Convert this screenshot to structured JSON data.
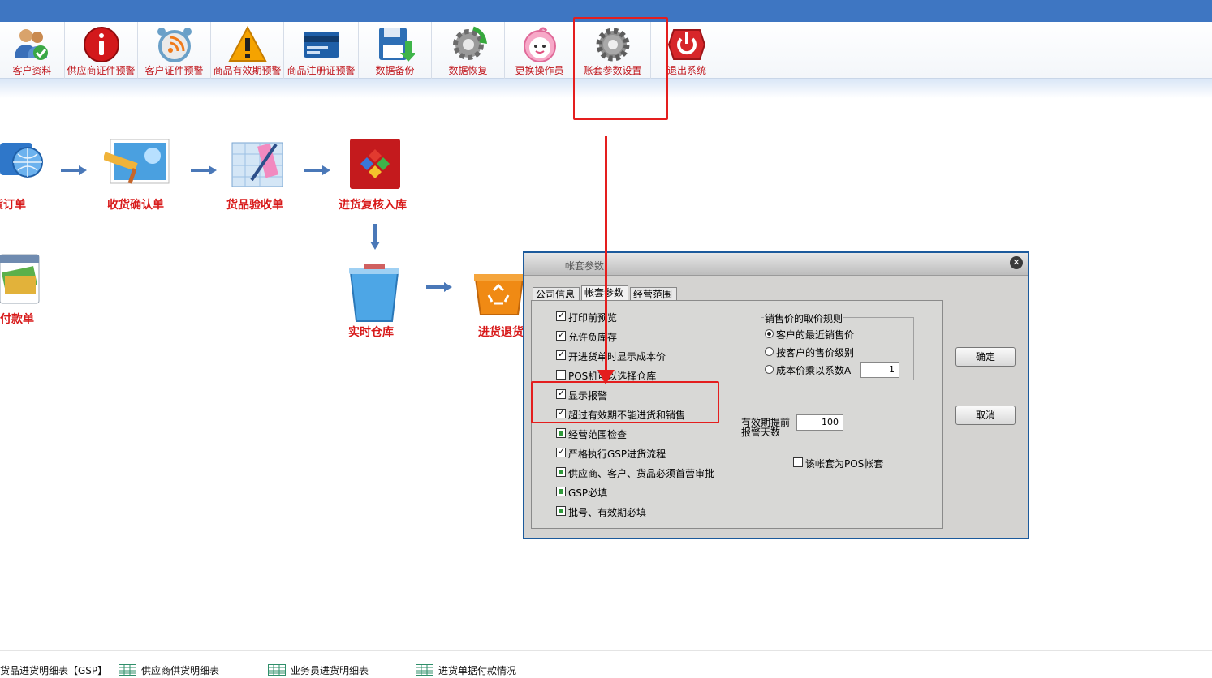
{
  "toolbar": {
    "buttons": [
      {
        "label": "客户资料",
        "icon": "users-check-icon"
      },
      {
        "label": "供应商证件预警",
        "icon": "info-red-icon"
      },
      {
        "label": "客户证件预警",
        "icon": "alarm-clock-rss-icon"
      },
      {
        "label": "商品有效期预警",
        "icon": "warning-triangle-icon"
      },
      {
        "label": "商品注册证预警",
        "icon": "credit-card-icon"
      },
      {
        "label": "数据备份",
        "icon": "floppy-download-icon"
      },
      {
        "label": "数据恢复",
        "icon": "gear-refresh-icon"
      },
      {
        "label": "更换操作员",
        "icon": "smiley-face-icon"
      },
      {
        "label": "账套参数设置",
        "icon": "gear-icon"
      },
      {
        "label": "退出系统",
        "icon": "power-icon"
      }
    ]
  },
  "flow": {
    "nodes": [
      {
        "label": "进货订单",
        "shown": "货订单"
      },
      {
        "label": "收货确认单"
      },
      {
        "label": "货品验收单"
      },
      {
        "label": "进货复核入库"
      },
      {
        "label": "付款单",
        "shown": "付款单"
      },
      {
        "label": "实时仓库"
      },
      {
        "label": "进货退货",
        "shown": "进货退货"
      }
    ]
  },
  "dialog": {
    "title": "帐套参数",
    "tabs": [
      "公司信息",
      "帐套参数",
      "经营范围"
    ],
    "active_tab": 1,
    "options": [
      {
        "label": "打印前预览",
        "state": "checked"
      },
      {
        "label": "允许负库存",
        "state": "checked"
      },
      {
        "label": "开进货单时显示成本价",
        "state": "checked"
      },
      {
        "label": "POS机可以选择仓库",
        "state": "unchecked"
      },
      {
        "label": "显示报警",
        "state": "checked"
      },
      {
        "label": "超过有效期不能进货和销售",
        "state": "checked"
      },
      {
        "label": "经营范围检查",
        "state": "indeterminate"
      },
      {
        "label": "严格执行GSP进货流程",
        "state": "checked"
      },
      {
        "label": "供应商、客户、货品必须首营审批",
        "state": "indeterminate"
      },
      {
        "label": "GSP必填",
        "state": "indeterminate"
      },
      {
        "label": "批号、有效期必填",
        "state": "indeterminate"
      }
    ],
    "price_rule": {
      "title": "销售价的取价规则",
      "options": [
        "客户的最近销售价",
        "按客户的售价级别",
        "成本价乘以系数A"
      ],
      "selected": 0,
      "coefficient": "1"
    },
    "expiry_warning": {
      "label_line1": "有效期提前",
      "label_line2": "报警天数",
      "value": "100"
    },
    "pos_account": {
      "label": "该帐套为POS帐套",
      "state": "unchecked"
    },
    "ok_label": "确定",
    "cancel_label": "取消"
  },
  "footer": {
    "reports": [
      {
        "label": "货品进货明细表【GSP】"
      },
      {
        "label": "供应商供货明细表"
      },
      {
        "label": "业务员进货明细表"
      },
      {
        "label": "进货单据付款情况"
      }
    ]
  },
  "colors": {
    "accent_blue": "#3e76c2",
    "label_red": "#d81a1a",
    "annotation_red": "#e41e1e"
  }
}
